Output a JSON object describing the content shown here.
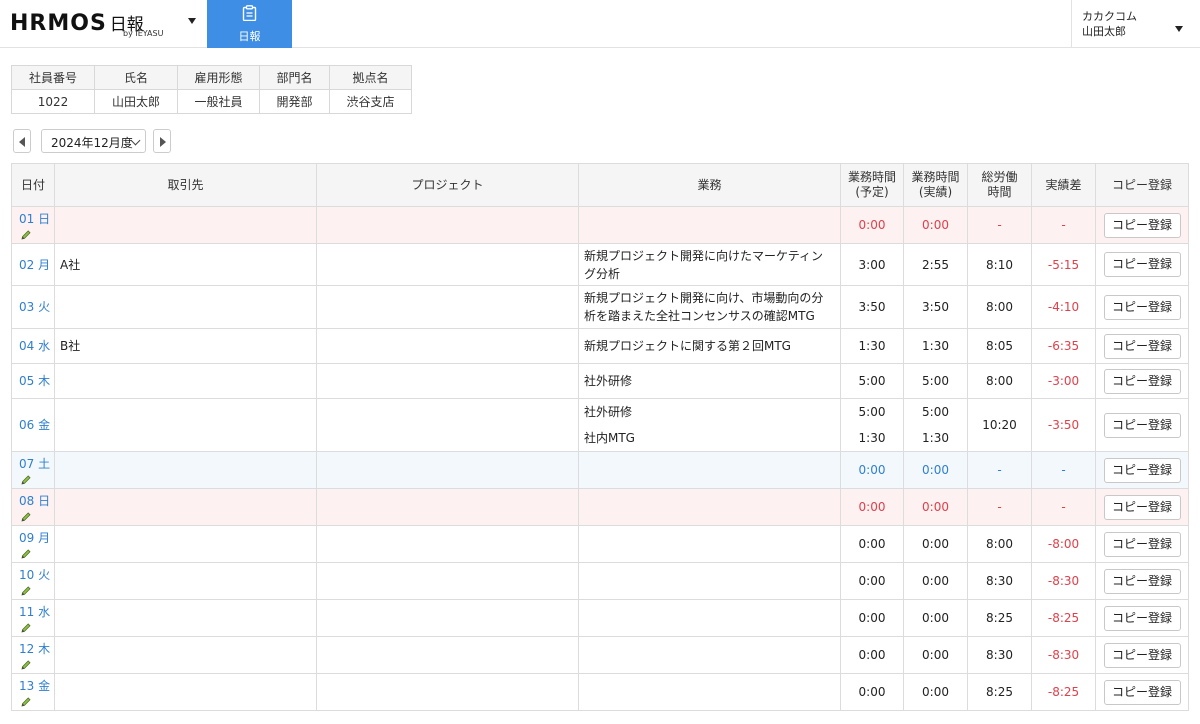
{
  "header": {
    "logo_text": "HRMOS",
    "logo_sub": "日報",
    "logo_by": "by IEYASU",
    "nav_tab": "日報",
    "company": "カカクコム",
    "user": "山田太郎",
    "accent_color": "#3d8ee4"
  },
  "employee": {
    "headers": [
      "社員番号",
      "氏名",
      "雇用形態",
      "部門名",
      "拠点名"
    ],
    "values": [
      "1022",
      "山田太郎",
      "一般社員",
      "開発部",
      "渋谷支店"
    ]
  },
  "month": {
    "label": "2024年12月度"
  },
  "table": {
    "headers": {
      "date": "日付",
      "client": "取引先",
      "project": "プロジェクト",
      "task": "業務",
      "planned_1": "業務時間",
      "planned_2": "(予定)",
      "actual_1": "業務時間",
      "actual_2": "(実績)",
      "total_1": "総労働",
      "total_2": "時間",
      "diff": "実績差",
      "copy": "コピー登録"
    },
    "copy_button": "コピー登録",
    "rows": [
      {
        "date": "01 日",
        "client": "",
        "project": "",
        "task": "",
        "planned": "0:00",
        "actual": "0:00",
        "total": "-",
        "diff": "-"
      },
      {
        "date": "02 月",
        "client": "A社",
        "project": "",
        "task": "新規プロジェクト開発に向けたマーケティング分析",
        "planned": "3:00",
        "actual": "2:55",
        "total": "8:10",
        "diff": "-5:15"
      },
      {
        "date": "03 火",
        "client": "",
        "project": "",
        "task": "新規プロジェクト開発に向け、市場動向の分析を踏まえた全社コンセンサスの確認MTG",
        "planned": "3:50",
        "actual": "3:50",
        "total": "8:00",
        "diff": "-4:10"
      },
      {
        "date": "04 水",
        "client": "B社",
        "project": "",
        "task": "新規プロジェクトに関する第２回MTG",
        "planned": "1:30",
        "actual": "1:30",
        "total": "8:05",
        "diff": "-6:35"
      },
      {
        "date": "05 木",
        "client": "",
        "project": "",
        "task": "社外研修",
        "planned": "5:00",
        "actual": "5:00",
        "total": "8:00",
        "diff": "-3:00"
      },
      {
        "date": "06 金",
        "client": "",
        "project": "",
        "task": "社外研修",
        "task_2": "社内MTG",
        "planned": "5:00",
        "planned_2": "1:30",
        "actual": "5:00",
        "actual_2": "1:30",
        "total": "10:20",
        "diff": "-3:50"
      },
      {
        "date": "07 土",
        "client": "",
        "project": "",
        "task": "",
        "planned": "0:00",
        "actual": "0:00",
        "total": "-",
        "diff": "-"
      },
      {
        "date": "08 日",
        "client": "",
        "project": "",
        "task": "",
        "planned": "0:00",
        "actual": "0:00",
        "total": "-",
        "diff": "-"
      },
      {
        "date": "09 月",
        "client": "",
        "project": "",
        "task": "",
        "planned": "0:00",
        "actual": "0:00",
        "total": "8:00",
        "diff": "-8:00"
      },
      {
        "date": "10 火",
        "client": "",
        "project": "",
        "task": "",
        "planned": "0:00",
        "actual": "0:00",
        "total": "8:30",
        "diff": "-8:30"
      },
      {
        "date": "11 水",
        "client": "",
        "project": "",
        "task": "",
        "planned": "0:00",
        "actual": "0:00",
        "total": "8:25",
        "diff": "-8:25"
      },
      {
        "date": "12 木",
        "client": "",
        "project": "",
        "task": "",
        "planned": "0:00",
        "actual": "0:00",
        "total": "8:30",
        "diff": "-8:30"
      },
      {
        "date": "13 金",
        "client": "",
        "project": "",
        "task": "",
        "planned": "0:00",
        "actual": "0:00",
        "total": "8:25",
        "diff": "-8:25"
      }
    ]
  },
  "icons": {
    "nav_tab": "clipboard-icon",
    "edit": "pencil-icon"
  }
}
